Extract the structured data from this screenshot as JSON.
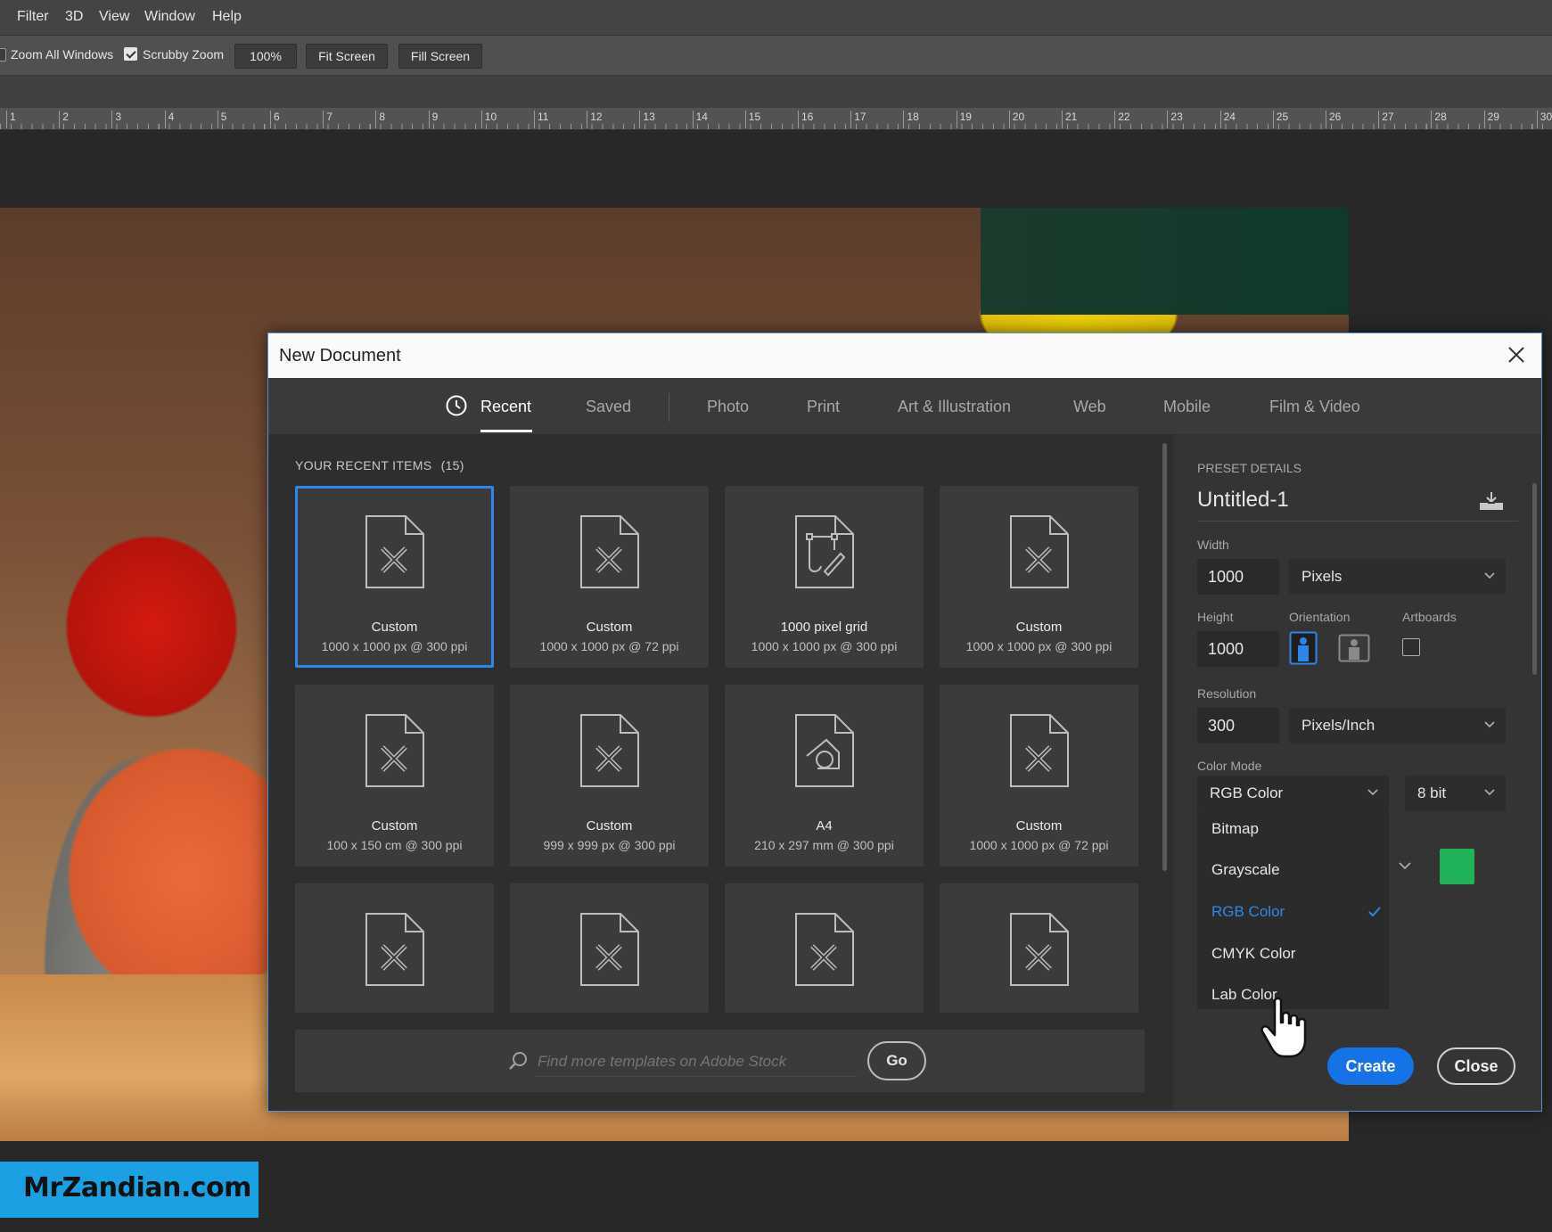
{
  "menubar": {
    "items": [
      "Filter",
      "3D",
      "View",
      "Window",
      "Help"
    ]
  },
  "options_bar": {
    "zoom_all_windows": {
      "label": "Zoom All Windows",
      "checked": false
    },
    "scrubby_zoom": {
      "label": "Scrubby Zoom",
      "checked": true
    },
    "zoom_value": "100%",
    "fit_screen": "Fit Screen",
    "fill_screen": "Fill Screen"
  },
  "ruler": {
    "numbers": [
      "1",
      "2",
      "3",
      "4",
      "5",
      "6",
      "7",
      "8",
      "9",
      "10",
      "11",
      "12",
      "13",
      "14",
      "15",
      "16",
      "17",
      "18",
      "19",
      "20",
      "21",
      "22",
      "23",
      "24",
      "25",
      "26",
      "27",
      "28",
      "29",
      "30"
    ]
  },
  "dialog": {
    "title": "New Document",
    "tabs": [
      {
        "label": "Recent",
        "active": true
      },
      {
        "label": "Saved",
        "active": false
      },
      {
        "label": "Photo",
        "active": false
      },
      {
        "label": "Print",
        "active": false
      },
      {
        "label": "Art & Illustration",
        "active": false
      },
      {
        "label": "Web",
        "active": false
      },
      {
        "label": "Mobile",
        "active": false
      },
      {
        "label": "Film & Video",
        "active": false
      }
    ],
    "recent": {
      "heading": "YOUR RECENT ITEMS",
      "count": "(15)",
      "tiles": [
        {
          "name": "Custom",
          "size": "1000 x 1000 px @ 300 ppi",
          "icon": "custom-doc-icon",
          "selected": true
        },
        {
          "name": "Custom",
          "size": "1000 x 1000 px @ 72 ppi",
          "icon": "custom-doc-icon"
        },
        {
          "name": "1000 pixel grid",
          "size": "1000 x 1000 px @ 300 ppi",
          "icon": "pixel-grid-doc-icon"
        },
        {
          "name": "Custom",
          "size": "1000 x 1000 px @ 300 ppi",
          "icon": "custom-doc-icon"
        },
        {
          "name": "Custom",
          "size": "100 x 150 cm @ 300 ppi",
          "icon": "custom-doc-icon"
        },
        {
          "name": "Custom",
          "size": "999 x 999 px @ 300 ppi",
          "icon": "custom-doc-icon"
        },
        {
          "name": "A4",
          "size": "210 x 297 mm @ 300 ppi",
          "icon": "a4-doc-icon"
        },
        {
          "name": "Custom",
          "size": "1000 x 1000 px @ 72 ppi",
          "icon": "custom-doc-icon"
        },
        {
          "name": "",
          "size": "",
          "icon": "custom-doc-icon"
        },
        {
          "name": "",
          "size": "",
          "icon": "custom-doc-icon"
        },
        {
          "name": "",
          "size": "",
          "icon": "custom-doc-icon"
        },
        {
          "name": "",
          "size": "",
          "icon": "custom-doc-icon"
        }
      ]
    },
    "search": {
      "placeholder": "Find more templates on Adobe Stock",
      "go": "Go"
    },
    "preset": {
      "heading": "PRESET DETAILS",
      "name": "Untitled-1",
      "width_label": "Width",
      "width": "1000",
      "width_unit": "Pixels",
      "height_label": "Height",
      "height": "1000",
      "orientation_label": "Orientation",
      "artboards_label": "Artboards",
      "resolution_label": "Resolution",
      "resolution": "300",
      "resolution_unit": "Pixels/Inch",
      "color_mode_label": "Color Mode",
      "color_mode": "RGB Color",
      "bit_depth": "8 bit",
      "color_mode_options": [
        "Bitmap",
        "Grayscale",
        "RGB Color",
        "CMYK Color",
        "Lab Color"
      ],
      "selected_color_mode": "RGB Color",
      "background_swatch": "#21b158"
    },
    "buttons": {
      "create": "Create",
      "close": "Close"
    }
  },
  "watermark": "MrZandian.com",
  "colors": {
    "accent": "#1473e6",
    "selection": "#2f86e8"
  }
}
